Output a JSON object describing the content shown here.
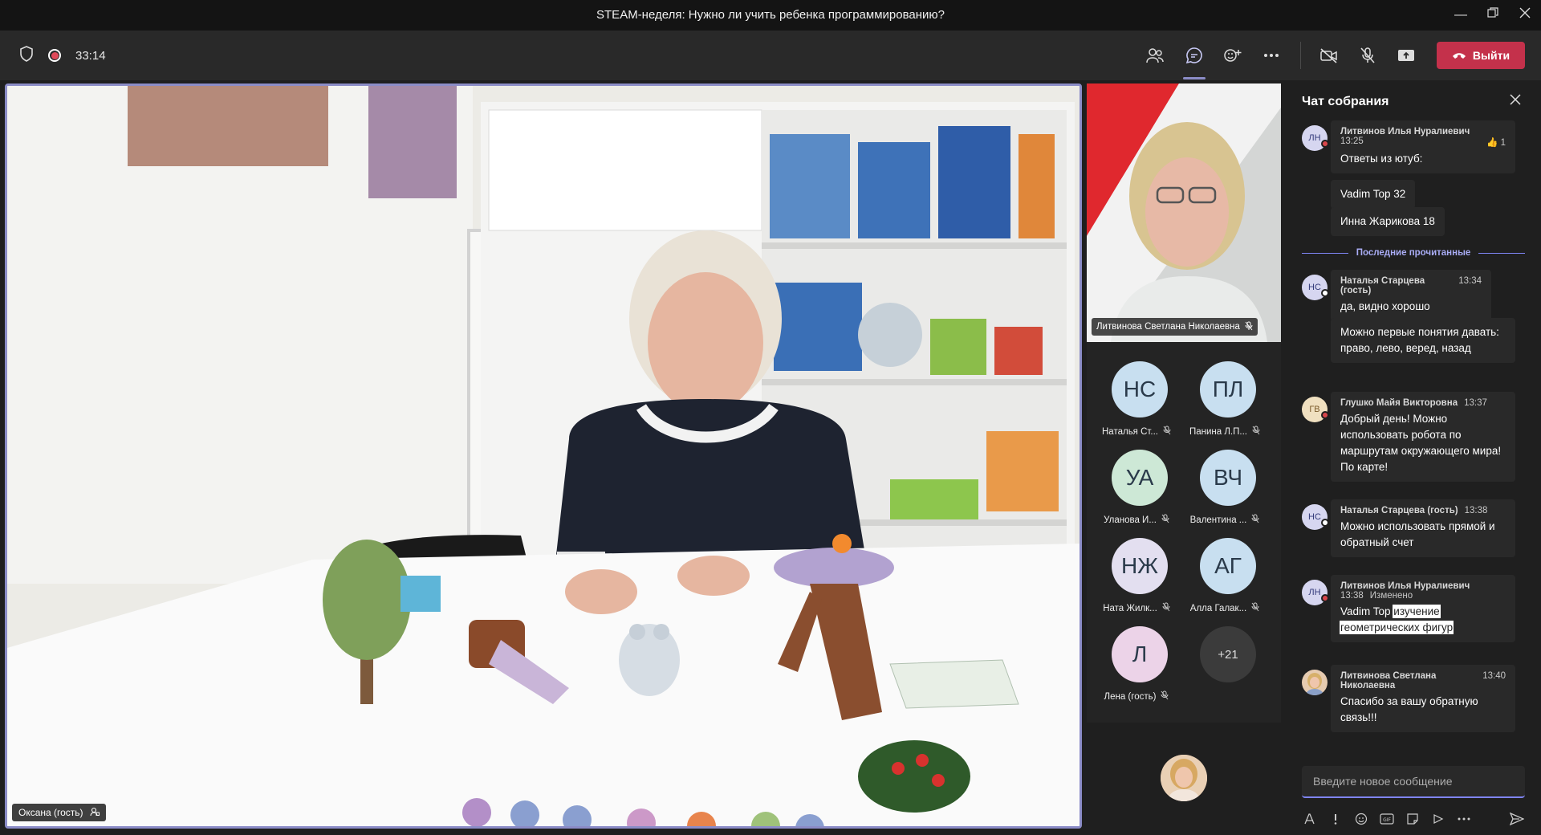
{
  "window": {
    "title": "STEAM-неделя: Нужно ли учить ребенка программированию?"
  },
  "toolbar": {
    "timer": "33:14",
    "leave_label": "Выйти"
  },
  "main_video": {
    "participant_name": "Оксана (гость)"
  },
  "featured": {
    "name": "Литвинова Светлана Николаевна"
  },
  "participants": [
    {
      "initials": "НС",
      "name": "Наталья Ст...",
      "color": "#c8dff0"
    },
    {
      "initials": "ПЛ",
      "name": "Панина Л.П...",
      "color": "#c8dff0"
    },
    {
      "initials": "УА",
      "name": "Уланова И...",
      "color": "#cde8d6"
    },
    {
      "initials": "ВЧ",
      "name": "Валентина ...",
      "color": "#c8dff0"
    },
    {
      "initials": "НЖ",
      "name": "Ната Жилк...",
      "color": "#e3dff0"
    },
    {
      "initials": "АГ",
      "name": "Алла Галак...",
      "color": "#c8dff0"
    },
    {
      "initials": "Л",
      "name": "Лена (гость)",
      "color": "#ecd3e8"
    }
  ],
  "more_count": "+21",
  "chat": {
    "header": "Чат собрания",
    "divider": "Последние прочитанные",
    "placeholder": "Введите новое сообщение",
    "m0": {
      "initials": "ЛН",
      "name": "Литвинов Илья Нуралиевич",
      "time": "13:25",
      "text": "Ответы из ютуб:",
      "reaction": "1"
    },
    "m0b": "Vadim Top 32",
    "m0c": "Инна Жарикова 18",
    "m1": {
      "initials": "НС",
      "name": "Наталья Старцева (гость)",
      "time": "13:34",
      "text": "да, видно хорошо"
    },
    "m1b": "Можно первые понятия давать: право, лево, веред, назад",
    "m2": {
      "initials": "ГВ",
      "name": "Глушко Майя Викторовна",
      "time": "13:37",
      "text": "Добрый день! Можно использовать робота по маршрутам окружающего мира! По карте!"
    },
    "m3": {
      "initials": "НС",
      "name": "Наталья Старцева (гость)",
      "time": "13:38",
      "text": "Можно использовать прямой и обратный счет"
    },
    "m4": {
      "initials": "ЛН",
      "name": "Литвинов Илья Нуралиевич",
      "time": "13:38",
      "edited": "Изменено",
      "text_a": "Vadim Top ",
      "text_b": "изучение геометрических фигур"
    },
    "m5": {
      "name": "Литвинова Светлана Николаевна",
      "time": "13:40",
      "text": "Спасибо за вашу обратную связь!!!"
    }
  }
}
